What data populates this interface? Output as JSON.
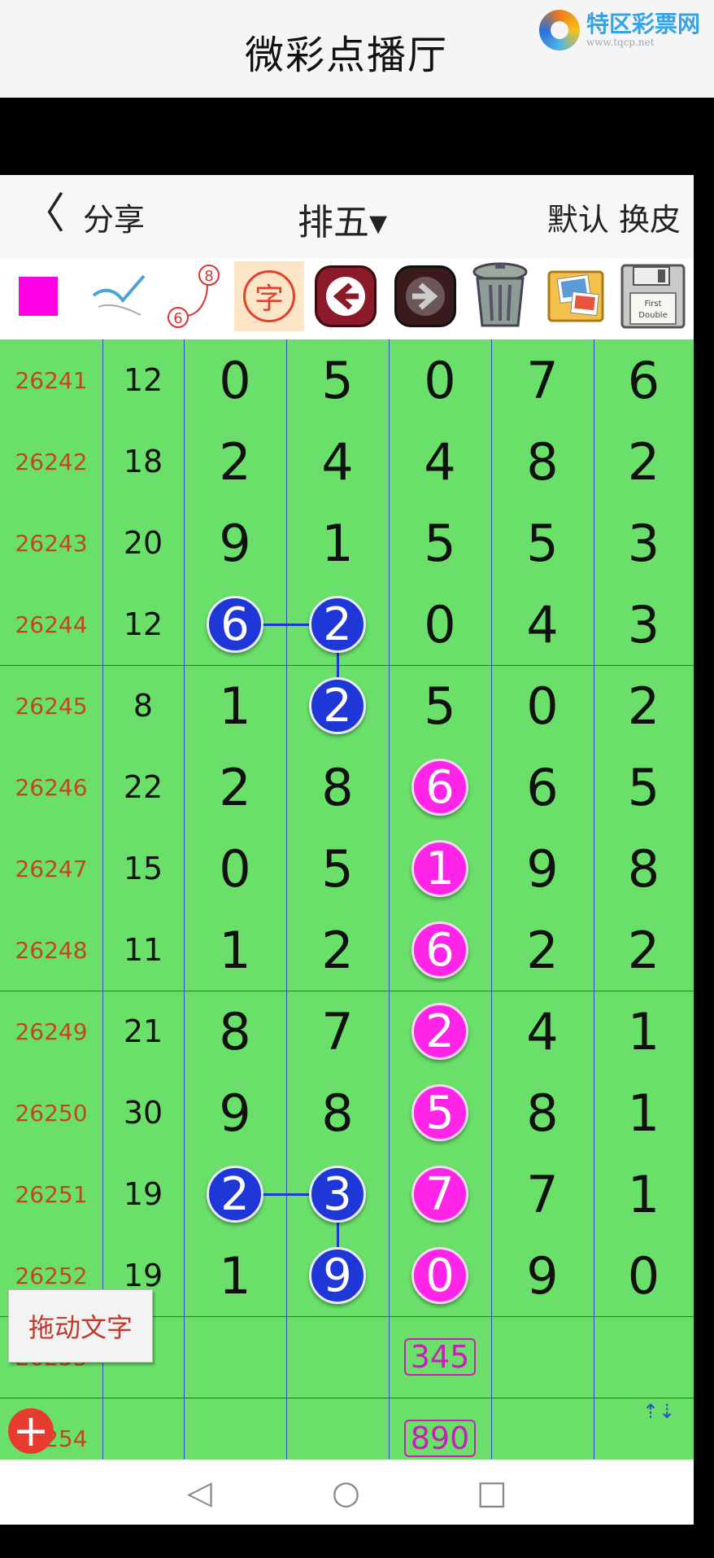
{
  "header": {
    "title": "微彩点播厅",
    "logo_text": "特区彩票网",
    "logo_url": "www.tqcp.net"
  },
  "nav": {
    "back": "〈",
    "share": "分享",
    "title": "排五▾",
    "right": "默认 换皮"
  },
  "toolbar": {
    "color": "#ff00e6",
    "tools": [
      "color-swatch",
      "pen-tool",
      "line-tool",
      "char-tool",
      "undo-arrow",
      "redo-arrow",
      "trash-can",
      "image-tool",
      "floppy-disk"
    ],
    "char_label": "字",
    "line_tool_labels": [
      "6",
      "8"
    ],
    "floppy_labels": [
      "First",
      "Double"
    ]
  },
  "rows": [
    {
      "issue": "26241",
      "sum": "12",
      "d": [
        "0",
        "5",
        "0",
        "7",
        "6"
      ]
    },
    {
      "issue": "26242",
      "sum": "18",
      "d": [
        "2",
        "4",
        "4",
        "8",
        "2"
      ]
    },
    {
      "issue": "26243",
      "sum": "20",
      "d": [
        "9",
        "1",
        "5",
        "5",
        "3"
      ]
    },
    {
      "issue": "26244",
      "sum": "12",
      "d": [
        "6",
        "2",
        "0",
        "4",
        "3"
      ]
    },
    {
      "issue": "26245",
      "sum": "8",
      "d": [
        "1",
        "2",
        "5",
        "0",
        "2"
      ]
    },
    {
      "issue": "26246",
      "sum": "22",
      "d": [
        "2",
        "8",
        "6",
        "6",
        "5"
      ]
    },
    {
      "issue": "26247",
      "sum": "15",
      "d": [
        "0",
        "5",
        "1",
        "9",
        "8"
      ]
    },
    {
      "issue": "26248",
      "sum": "11",
      "d": [
        "1",
        "2",
        "6",
        "2",
        "2"
      ]
    },
    {
      "issue": "26249",
      "sum": "21",
      "d": [
        "8",
        "7",
        "2",
        "4",
        "1"
      ]
    },
    {
      "issue": "26250",
      "sum": "30",
      "d": [
        "9",
        "8",
        "5",
        "8",
        "1"
      ]
    },
    {
      "issue": "26251",
      "sum": "19",
      "d": [
        "2",
        "3",
        "7",
        "7",
        "1"
      ]
    },
    {
      "issue": "26252",
      "sum": "19",
      "d": [
        "1",
        "9",
        "0",
        "9",
        "0"
      ]
    },
    {
      "issue": "26253",
      "sum": "",
      "d": [
        "",
        "",
        "",
        "",
        ""
      ]
    },
    {
      "issue": "26254",
      "sum": "",
      "d": [
        "",
        "",
        "",
        "",
        ""
      ]
    }
  ],
  "marks": [
    {
      "row": 3,
      "col": 0,
      "color": "blue"
    },
    {
      "row": 3,
      "col": 1,
      "color": "blue"
    },
    {
      "row": 4,
      "col": 1,
      "color": "blue"
    },
    {
      "row": 5,
      "col": 2,
      "color": "pink"
    },
    {
      "row": 6,
      "col": 2,
      "color": "pink"
    },
    {
      "row": 7,
      "col": 2,
      "color": "pink"
    },
    {
      "row": 8,
      "col": 2,
      "color": "pink"
    },
    {
      "row": 9,
      "col": 2,
      "color": "pink"
    },
    {
      "row": 10,
      "col": 2,
      "color": "pink"
    },
    {
      "row": 11,
      "col": 2,
      "color": "pink"
    },
    {
      "row": 10,
      "col": 0,
      "color": "blue"
    },
    {
      "row": 10,
      "col": 1,
      "color": "blue"
    },
    {
      "row": 11,
      "col": 1,
      "color": "blue"
    }
  ],
  "predictions": [
    "345",
    "890"
  ],
  "drag_text": "拖动文字",
  "add_button": "+",
  "vertical_switch": "⇡⇣",
  "system_nav": {
    "back": "◁",
    "home": "○",
    "recent": "□"
  },
  "colors": {
    "grid_bg": "#6ae06a",
    "ball_blue": "#1f37d6",
    "ball_pink": "#ff24e8",
    "issue_text": "#c4461b"
  }
}
